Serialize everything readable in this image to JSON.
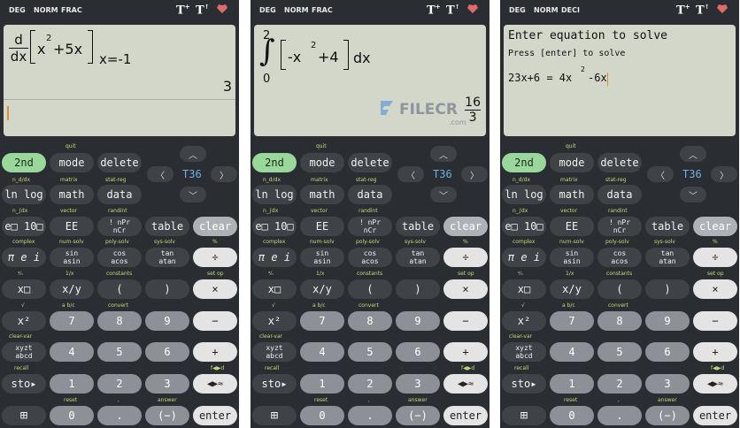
{
  "panels": [
    {
      "status": {
        "mode1": "DEG",
        "mode2": "NORM",
        "mode3": "FRAC"
      },
      "display": {
        "num": "d",
        "den": "dx",
        "base1": "x",
        "exp1": "2",
        "op": "+5x",
        "where": "x=-1",
        "result": "3"
      }
    },
    {
      "status": {
        "mode1": "DEG",
        "mode2": "NORM",
        "mode3": "FRAC"
      },
      "display": {
        "upper": "2",
        "lower": "0",
        "integral": "∫",
        "neg": "-x",
        "exp": "2",
        "rest": "+4",
        "dx": "dx",
        "res_num": "16",
        "res_den": "3"
      },
      "watermark": {
        "brand": "FILECR",
        "sub": ".com"
      }
    },
    {
      "status": {
        "mode1": "DEG",
        "mode2": "NORM",
        "mode3": "DECI"
      },
      "display": {
        "title": "Enter equation to solve",
        "hint": "Press [enter] to solve",
        "lhs": "23x+6 = 4x",
        "exp": "2",
        "rhs": "-6x"
      }
    }
  ],
  "keypad": {
    "icons": {
      "t_plus": "T+",
      "t_up": "T↑",
      "heart": "heart-icon"
    },
    "t36": "T36",
    "row1": {
      "k1": "2nd",
      "k2": "mode",
      "k3": "delete",
      "l2": "quit"
    },
    "row2": {
      "k1": "ln log",
      "k2": "math",
      "k3": "data",
      "l1": "n_d/dx",
      "l2": "matrix",
      "l3": "stat-reg"
    },
    "row3": {
      "k1": "e□ 10□",
      "k2": "EE",
      "k3a": "! nPr",
      "k3b": "nCr",
      "k4": "table",
      "k5": "clear",
      "l1": "n_∫dx",
      "l2": "vector",
      "l3": "randint"
    },
    "row4": {
      "k1": "π e i",
      "k2a": "sin",
      "k2b": "asin",
      "k3a": "cos",
      "k3b": "acos",
      "k4a": "tan",
      "k4b": "atan",
      "k5": "÷",
      "l1": "complex",
      "l2": "num-solv",
      "l3": "poly-solv",
      "l4": "sys-solv",
      "l5": "%"
    },
    "row5": {
      "k1": "x□",
      "k2": "x/y",
      "k3": "(",
      "k4": ")",
      "k5": "×",
      "l1": "ᵃ⁄ₙ",
      "l2": "1/x",
      "l3": "constants",
      "l5": "set op"
    },
    "row6": {
      "k1": "x²",
      "k2": "7",
      "k3": "8",
      "k4": "9",
      "k5": "−",
      "l1": "√",
      "l2": "a b/c",
      "l3": "convert"
    },
    "row7": {
      "k1a": "xyzt",
      "k1b": "abcd",
      "k2": "4",
      "k3": "5",
      "k4": "6",
      "k5": "+",
      "l1": "clear-var"
    },
    "row8": {
      "k1": "sto▸",
      "k2": "1",
      "k3": "2",
      "k4": "3",
      "k5": "◀▶≈",
      "l1": "recall",
      "l5": "f◀▶d"
    },
    "row9": {
      "k1": "⊞",
      "k2": "0",
      "k3": ".",
      "k4": "(−)",
      "k5": "enter",
      "l2": "reset",
      "l3": ",",
      "l4": "answer"
    }
  },
  "colors": {
    "body": "#2a2d31",
    "screen": "#d2d7ca",
    "green": "#9ad79b",
    "label": "#c9d97a",
    "t36": "#6fb0e0"
  }
}
